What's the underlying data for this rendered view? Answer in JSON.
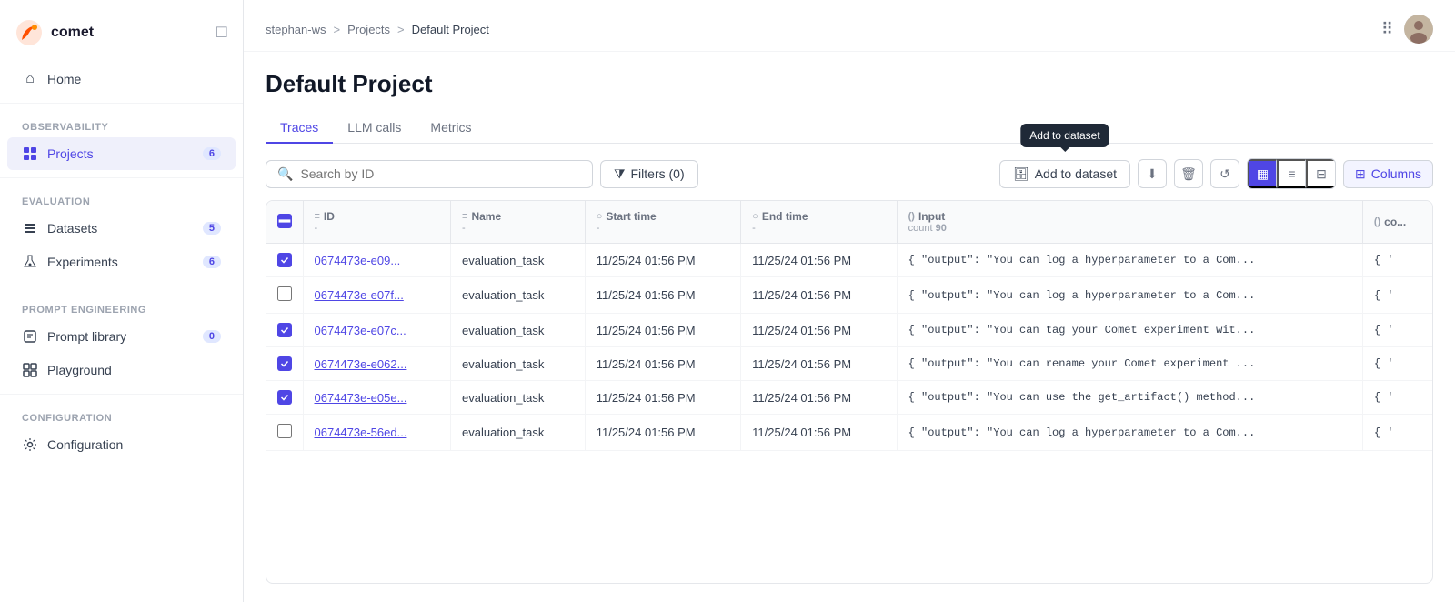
{
  "sidebar": {
    "logo_text": "comet",
    "home_label": "Home",
    "observability_title": "Observability",
    "projects_label": "Projects",
    "projects_badge": "6",
    "evaluation_title": "Evaluation",
    "datasets_label": "Datasets",
    "datasets_badge": "5",
    "experiments_label": "Experiments",
    "experiments_badge": "6",
    "prompt_engineering_title": "Prompt engineering",
    "prompt_library_label": "Prompt library",
    "prompt_library_badge": "0",
    "playground_label": "Playground",
    "configuration_title": "Configuration",
    "configuration_label": "Configuration"
  },
  "breadcrumb": {
    "workspace": "stephan-ws",
    "sep1": ">",
    "projects": "Projects",
    "sep2": ">",
    "current": "Default Project"
  },
  "page": {
    "title": "Default Project"
  },
  "tabs": [
    {
      "id": "traces",
      "label": "Traces",
      "active": true
    },
    {
      "id": "llm-calls",
      "label": "LLM calls",
      "active": false
    },
    {
      "id": "metrics",
      "label": "Metrics",
      "active": false
    }
  ],
  "toolbar": {
    "search_placeholder": "Search by ID",
    "filter_btn": "Filters (0)",
    "add_dataset_btn": "Add to dataset",
    "add_dataset_tooltip": "Add to dataset",
    "columns_btn": "Columns"
  },
  "table": {
    "columns": [
      {
        "id": "id",
        "label": "ID",
        "icon": "≡",
        "sub": "-"
      },
      {
        "id": "name",
        "label": "Name",
        "icon": "≡",
        "sub": "-"
      },
      {
        "id": "start_time",
        "label": "Start time",
        "icon": "○",
        "sub": "-"
      },
      {
        "id": "end_time",
        "label": "End time",
        "icon": "○",
        "sub": "-"
      },
      {
        "id": "input",
        "label": "Input",
        "icon": "()",
        "sub": "count 90"
      },
      {
        "id": "output",
        "label": "co...",
        "icon": "()",
        "sub": ""
      }
    ],
    "rows": [
      {
        "id": "0674473e-e09...",
        "name": "evaluation_task",
        "start_time": "11/25/24 01:56 PM",
        "end_time": "11/25/24 01:56 PM",
        "input": "{ \"output\": \"You can log a hyperparameter to a Com...",
        "output": "{ '",
        "checked": true
      },
      {
        "id": "0674473e-e07f...",
        "name": "evaluation_task",
        "start_time": "11/25/24 01:56 PM",
        "end_time": "11/25/24 01:56 PM",
        "input": "{ \"output\": \"You can log a hyperparameter to a Com...",
        "output": "{ '",
        "checked": false
      },
      {
        "id": "0674473e-e07c...",
        "name": "evaluation_task",
        "start_time": "11/25/24 01:56 PM",
        "end_time": "11/25/24 01:56 PM",
        "input": "{ \"output\": \"You can tag your Comet experiment wit...",
        "output": "{ '",
        "checked": true
      },
      {
        "id": "0674473e-e062...",
        "name": "evaluation_task",
        "start_time": "11/25/24 01:56 PM",
        "end_time": "11/25/24 01:56 PM",
        "input": "{ \"output\": \"You can rename your Comet experiment ...",
        "output": "{ '",
        "checked": true
      },
      {
        "id": "0674473e-e05e...",
        "name": "evaluation_task",
        "start_time": "11/25/24 01:56 PM",
        "end_time": "11/25/24 01:56 PM",
        "input": "{ \"output\": \"You can use the get_artifact() method...",
        "output": "{ '",
        "checked": true
      },
      {
        "id": "0674473e-56ed...",
        "name": "evaluation_task",
        "start_time": "11/25/24 01:56 PM",
        "end_time": "11/25/24 01:56 PM",
        "input": "{ \"output\": \"You can log a hyperparameter to a Com...",
        "output": "{ '",
        "checked": false
      }
    ]
  }
}
